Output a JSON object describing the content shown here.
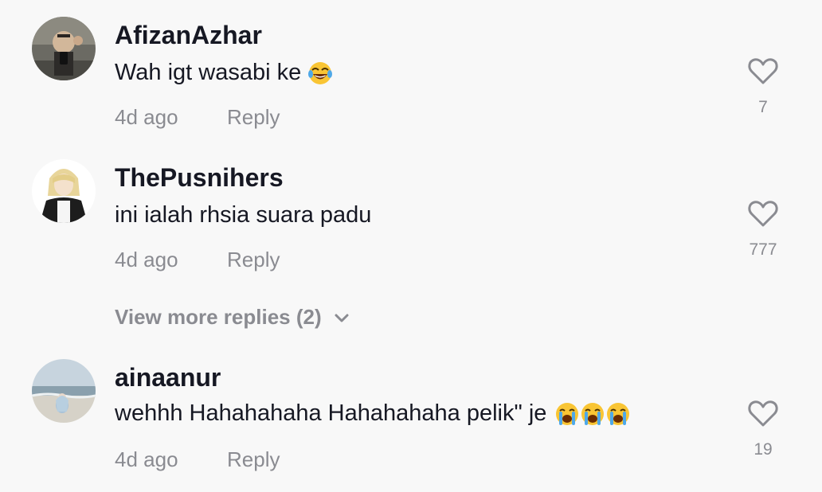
{
  "comments": [
    {
      "username": "AfizanAzhar",
      "text": "Wah igt wasabi ke",
      "emojis": [
        "face-with-tears-of-joy"
      ],
      "time": "4d ago",
      "reply_label": "Reply",
      "likes": "7"
    },
    {
      "username": "ThePusnihers",
      "text": "ini ialah rhsia suara padu",
      "emojis": [],
      "time": "4d ago",
      "reply_label": "Reply",
      "likes": "777"
    },
    {
      "username": "ainaanur",
      "text": "wehhh Hahahahaha Hahahahaha pelik\" je",
      "emojis": [
        "loudly-crying-face",
        "loudly-crying-face",
        "loudly-crying-face"
      ],
      "time": "4d ago",
      "reply_label": "Reply",
      "likes": "19"
    }
  ],
  "view_more": {
    "label": "View more replies (2)",
    "icon": "chevron-down-icon"
  },
  "colors": {
    "background": "#f8f8f8",
    "primary_text": "#161823",
    "secondary_text": "#8a8b91",
    "heart_outline": "#8a8b91"
  }
}
